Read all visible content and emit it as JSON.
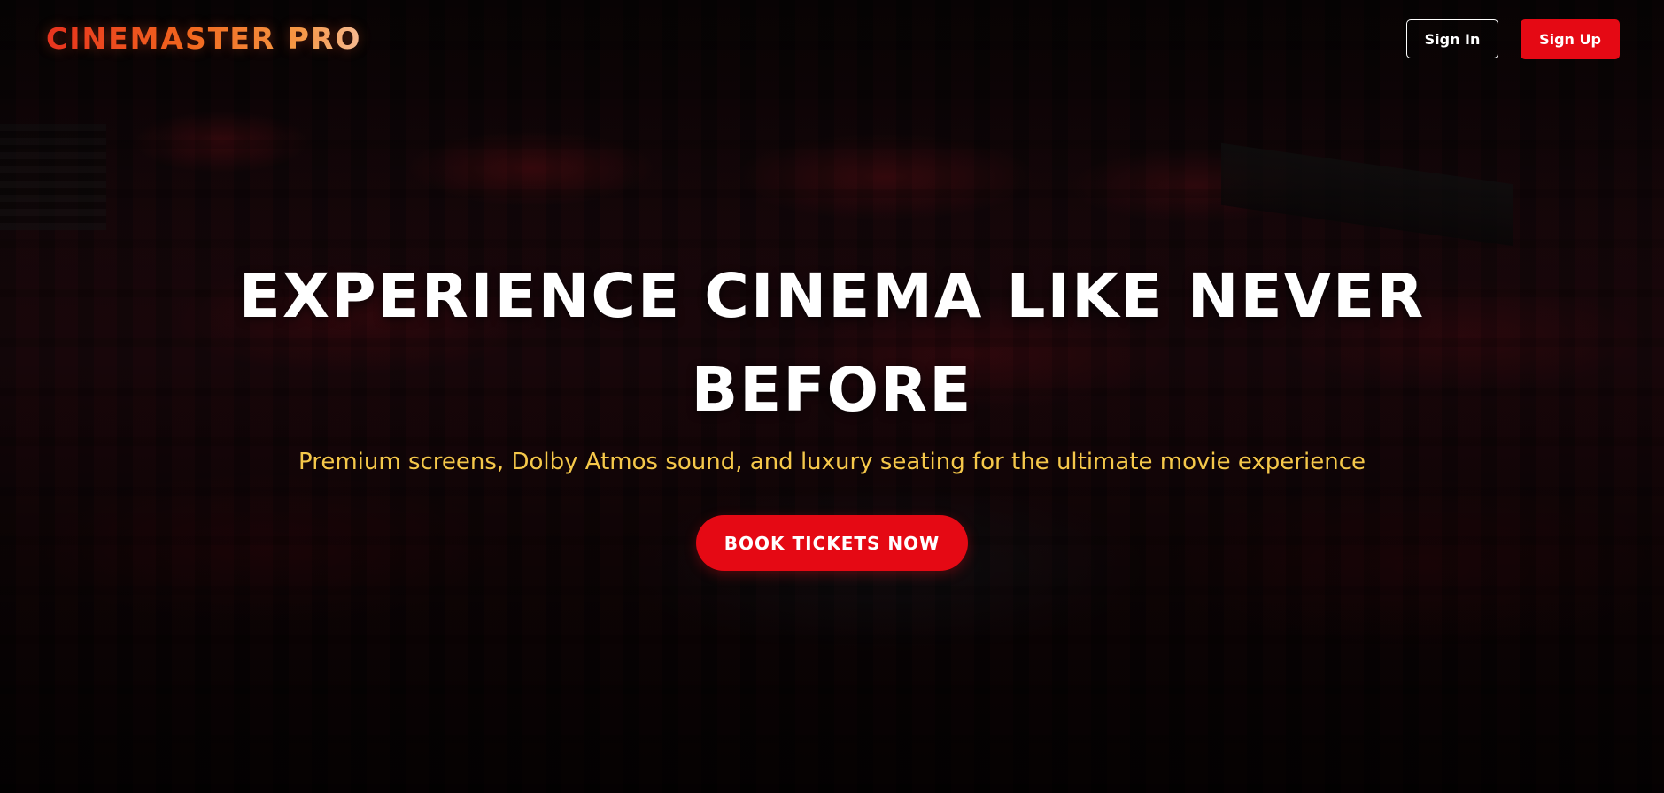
{
  "brand": {
    "name": "CINEMASTER PRO",
    "accent": "#e50914",
    "gradient_start": "#e8301f",
    "gradient_end": "#f8c7a0"
  },
  "header": {
    "sign_in_label": "Sign In",
    "sign_up_label": "Sign Up"
  },
  "hero": {
    "title": "EXPERIENCE CINEMA LIKE NEVER BEFORE",
    "subtitle": "Premium screens, Dolby Atmos sound, and luxury seating for the ultimate movie experience",
    "subtitle_color": "#f5c84a",
    "cta_label": "BOOK TICKETS NOW",
    "background": "dark cinema audience photo"
  }
}
